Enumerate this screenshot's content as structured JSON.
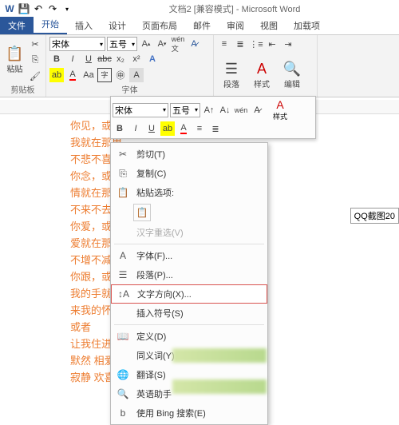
{
  "title": "文档2 [兼容模式] - Microsoft Word",
  "qat": {
    "save": "💾",
    "undo": "↶",
    "redo": "↷"
  },
  "tabs": {
    "file": "文件",
    "items": [
      "开始",
      "插入",
      "设计",
      "页面布局",
      "邮件",
      "审阅",
      "视图",
      "加载项"
    ]
  },
  "ribbon": {
    "clipboard": {
      "paste": "粘贴",
      "label": "剪贴板"
    },
    "font": {
      "name": "宋体",
      "size": "五号",
      "label": "字体"
    },
    "para": {
      "label": "段落"
    },
    "styles": {
      "label": "样式"
    },
    "edit": {
      "label": "编辑"
    }
  },
  "mini": {
    "font": "宋体",
    "size": "五号",
    "styles": "样式"
  },
  "doc_lines": [
    "你见，或",
    "我就在那里",
    "不悲不喜",
    "你念，或",
    "情就在那",
    "不来不去",
    "你爱，或",
    "爱就在那",
    "不增不减",
    "你跟，或",
    "我的手就",
    "来我的怀",
    "或者",
    "让我住进",
    "默然 相爱",
    "寂静 欢喜"
  ],
  "context": {
    "cut": "剪切(T)",
    "copy": "复制(C)",
    "paste_opts": "粘贴选项:",
    "hanzi": "汉字重选(V)",
    "font": "字体(F)...",
    "para": "段落(P)...",
    "textdir": "文字方向(X)...",
    "symbol": "插入符号(S)",
    "define": "定义(D)",
    "synonym": "同义词(Y)",
    "translate": "翻译(S)",
    "english": "英语助手",
    "bing": "使用 Bing 搜索(E)"
  },
  "qqtag": "QQ截图20"
}
